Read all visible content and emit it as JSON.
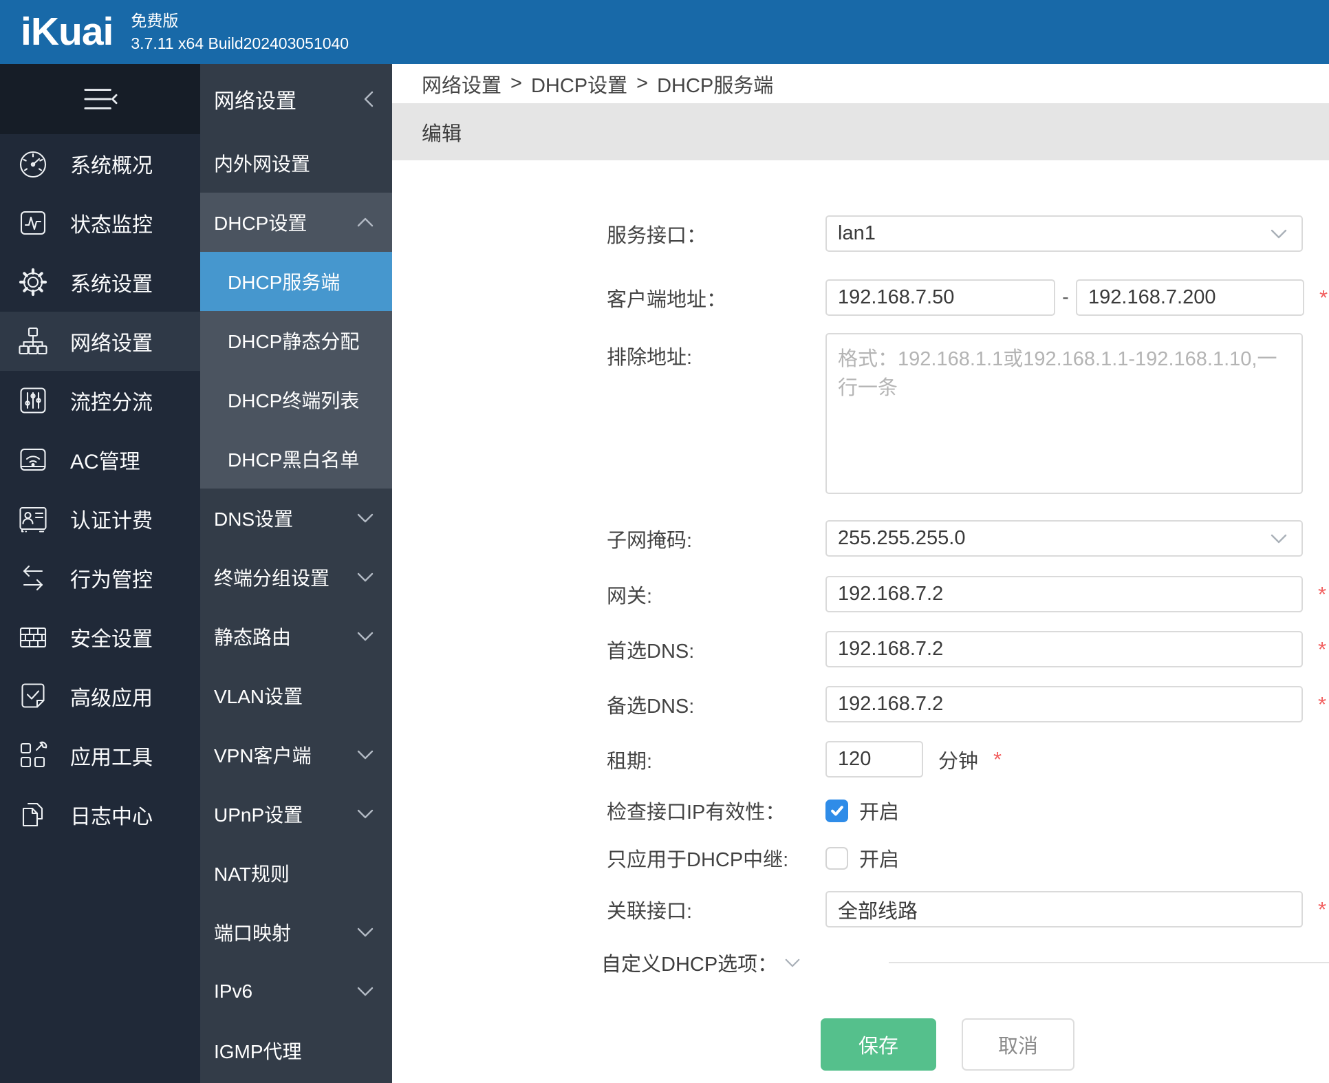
{
  "topbar": {
    "logo": "iKuai",
    "edition": "免费版",
    "version": "3.7.11 x64 Build202403051040"
  },
  "colors": {
    "topbar_blue": "#1869a8",
    "sidebar_bg": "#202938",
    "sidebar_head_bg": "#161d27",
    "sidebar_active_bg": "#2f3947",
    "submenu_bg": "#333c48",
    "group_bg": "#4b5460",
    "selected_blue": "#4697ce",
    "editbar_gray": "#e5e5e5",
    "save_green": "#55c08c",
    "checkbox_blue": "#2f8ce8",
    "required_red": "#f25f5f"
  },
  "sidebar": {
    "items": [
      {
        "label": "系统概况",
        "icon": "gauge-icon",
        "active": false
      },
      {
        "label": "状态监控",
        "icon": "monitor-wave-icon",
        "active": false
      },
      {
        "label": "系统设置",
        "icon": "gear-icon",
        "active": false
      },
      {
        "label": "网络设置",
        "icon": "network-sitemap-icon",
        "active": true
      },
      {
        "label": "流控分流",
        "icon": "sliders-icon",
        "active": false
      },
      {
        "label": "AC管理",
        "icon": "wifi-ap-icon",
        "active": false
      },
      {
        "label": "认证计费",
        "icon": "id-card-icon",
        "active": false
      },
      {
        "label": "行为管控",
        "icon": "swap-arrows-icon",
        "active": false
      },
      {
        "label": "安全设置",
        "icon": "firewall-icon",
        "active": false
      },
      {
        "label": "高级应用",
        "icon": "doc-check-icon",
        "active": false
      },
      {
        "label": "应用工具",
        "icon": "tools-wrench-icon",
        "active": false
      },
      {
        "label": "日志中心",
        "icon": "copy-pages-icon",
        "active": false
      }
    ]
  },
  "submenu": {
    "items": [
      {
        "label": "网络设置",
        "type": "title",
        "chevron": "left"
      },
      {
        "label": "内外网设置",
        "chevron": "none"
      },
      {
        "label": "DHCP设置",
        "chevron": "up",
        "group": true
      },
      {
        "label": "DHCP服务端",
        "sub": true,
        "group": true,
        "selected": true
      },
      {
        "label": "DHCP静态分配",
        "sub": true,
        "group": true
      },
      {
        "label": "DHCP终端列表",
        "sub": true,
        "group": true
      },
      {
        "label": "DHCP黑白名单",
        "sub": true,
        "group": true
      },
      {
        "label": "DNS设置",
        "chevron": "down"
      },
      {
        "label": "终端分组设置",
        "chevron": "down"
      },
      {
        "label": "静态路由",
        "chevron": "down"
      },
      {
        "label": "VLAN设置",
        "chevron": "none"
      },
      {
        "label": "VPN客户端",
        "chevron": "down"
      },
      {
        "label": "UPnP设置",
        "chevron": "down"
      },
      {
        "label": "NAT规则",
        "chevron": "none"
      },
      {
        "label": "端口映射",
        "chevron": "down"
      },
      {
        "label": "IPv6",
        "chevron": "down"
      },
      {
        "label": "IGMP代理",
        "chevron": "none"
      }
    ]
  },
  "breadcrumb": {
    "parts": [
      "网络设置",
      "DHCP设置",
      "DHCP服务端"
    ],
    "separator": ">"
  },
  "panel": {
    "title": "编辑"
  },
  "form": {
    "required_marker": "*",
    "service_interface": {
      "label": "服务接口：",
      "value": "lan1"
    },
    "client_addr": {
      "label": "客户端地址：",
      "start": "192.168.7.50",
      "separator": "-",
      "end": "192.168.7.200",
      "required": true
    },
    "exclude_addr": {
      "label": "排除地址:",
      "placeholder": "格式：192.168.1.1或192.168.1.1-192.168.1.10,一行一条"
    },
    "netmask": {
      "label": "子网掩码:",
      "value": "255.255.255.0"
    },
    "gateway": {
      "label": "网关:",
      "value": "192.168.7.2",
      "required": true
    },
    "primary_dns": {
      "label": "首选DNS:",
      "value": "192.168.7.2",
      "required": true
    },
    "secondary_dns": {
      "label": "备选DNS:",
      "value": "192.168.7.2",
      "required": true
    },
    "lease": {
      "label": "租期:",
      "value": "120",
      "unit": "分钟",
      "required": true
    },
    "check_ip": {
      "label": "检查接口IP有效性：",
      "checked": true,
      "text": "开启"
    },
    "dhcp_relay": {
      "label": "只应用于DHCP中继:",
      "checked": false,
      "text": "开启"
    },
    "bind_interface": {
      "label": "关联接口:",
      "value": "全部线路",
      "required": true
    },
    "custom_dhcp": {
      "label": "自定义DHCP选项："
    }
  },
  "actions": {
    "save": "保存",
    "cancel": "取消"
  }
}
